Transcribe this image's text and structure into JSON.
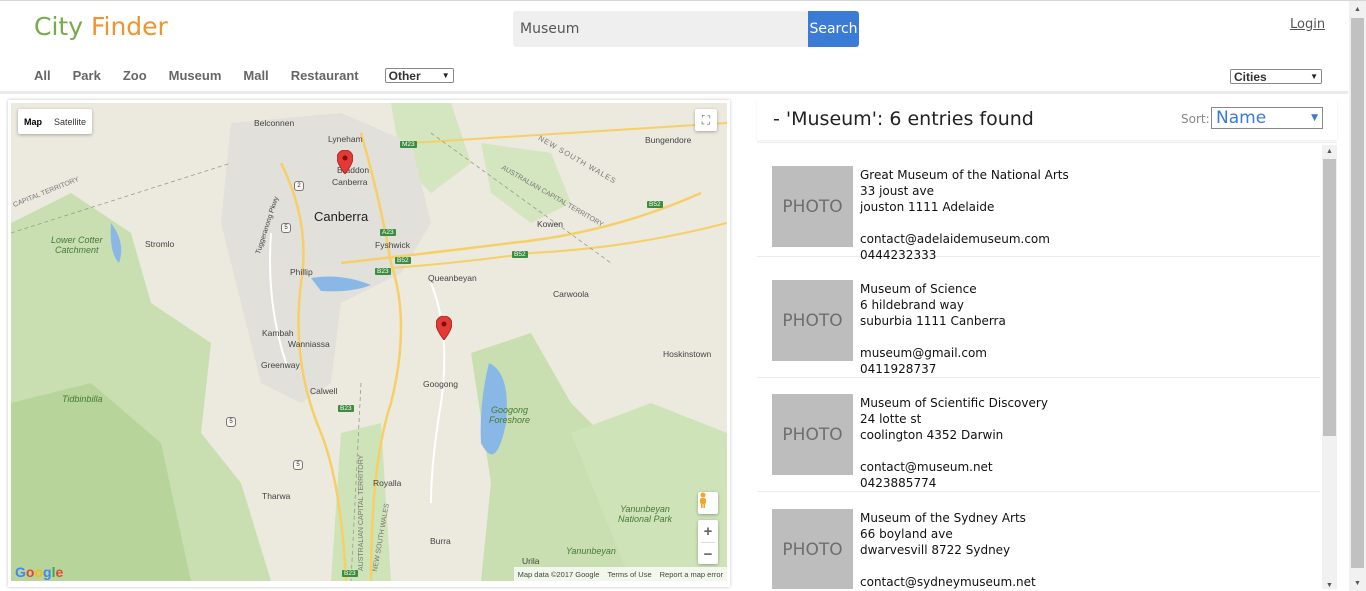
{
  "app": {
    "title_part1": "City",
    "title_part2": "Finder",
    "brand_green": "#78a94a",
    "brand_orange": "#f0952e",
    "accent": "#3a7bd5"
  },
  "search": {
    "value": "Museum",
    "button": "Search"
  },
  "login": "Login",
  "categories": [
    "All",
    "Park",
    "Zoo",
    "Museum",
    "Mall",
    "Restaurant"
  ],
  "other_select": "Other",
  "cities_select": "Cities",
  "map": {
    "type_map": "Map",
    "type_satellite": "Satellite",
    "google": "Google",
    "footer": {
      "data": "Map data ©2017 Google",
      "terms": "Terms of Use",
      "report": "Report a map error"
    },
    "places": {
      "belconnen": "Belconnen",
      "lyneham": "Lyneham",
      "braddon": "Braddon",
      "canberra_small": "Canberra",
      "canberra": "Canberra",
      "bungendore": "Bungendore",
      "nsw": "NEW SOUTH WALES",
      "act_top": "AUSTRALIAN CAPITAL TERRITORY",
      "act_left": "CAPITAL TERRITORY",
      "kowen": "Kowen",
      "lower_cotter": "Lower Cotter\nCatchment",
      "stromlo": "Stromlo",
      "fyshwick": "Fyshwick",
      "queanbeyan": "Queanbeyan",
      "phillip": "Phillip",
      "carwoola": "Carwoola",
      "kambah": "Kambah",
      "wanniassa": "Wanniassa",
      "greenway": "Greenway",
      "hoskinstown": "Hoskinstown",
      "calwell": "Calwell",
      "googong": "Googong",
      "tidbinbilla": "Tidbinbilla",
      "googong_foreshore": "Googong\nForeshore",
      "tharwa": "Tharwa",
      "royalla": "Royalla",
      "yanunbeyan_np": "Yanunbeyan\nNational Park",
      "burra": "Burra",
      "yanunbeyan": "Yanunbeyan",
      "urila": "Urila",
      "tuggeranong": "Tuggeranong Pkwy",
      "act_vertical": "AUSTRALIAN CAPITAL TERRITORY",
      "nsw_vertical": "NEW SOUTH WALES",
      "m23": "M23",
      "b52a": "B52",
      "b52b": "B52",
      "b52c": "B52",
      "a23": "A23",
      "b23a": "B23",
      "b23b": "B23",
      "b23c": "B23",
      "r2": "2",
      "r5a": "5",
      "r5b": "5",
      "r5c": "5"
    }
  },
  "results": {
    "title": "- 'Museum': 6 entries found",
    "sort_label": "Sort:",
    "sort_value": "Name",
    "photo_label": "PHOTO",
    "items": [
      {
        "name": "Great Museum of the National Arts",
        "street": "33 joust ave",
        "suburb": "jouston 1111 Adelaide",
        "email": "contact@adelaidemuseum.com",
        "phone": "0444232333"
      },
      {
        "name": "Museum of Science",
        "street": "6 hildebrand way",
        "suburb": "suburbia 1111 Canberra",
        "email": "museum@gmail.com",
        "phone": "0411928737"
      },
      {
        "name": "Museum of Scientific Discovery",
        "street": "24 lotte st",
        "suburb": "coolington 4352 Darwin",
        "email": "contact@museum.net",
        "phone": "0423885774"
      },
      {
        "name": "Museum of the Sydney Arts",
        "street": "66 boyland ave",
        "suburb": "dwarvesvill 8722 Sydney",
        "email": "contact@sydneymuseum.net",
        "phone": ""
      }
    ]
  }
}
